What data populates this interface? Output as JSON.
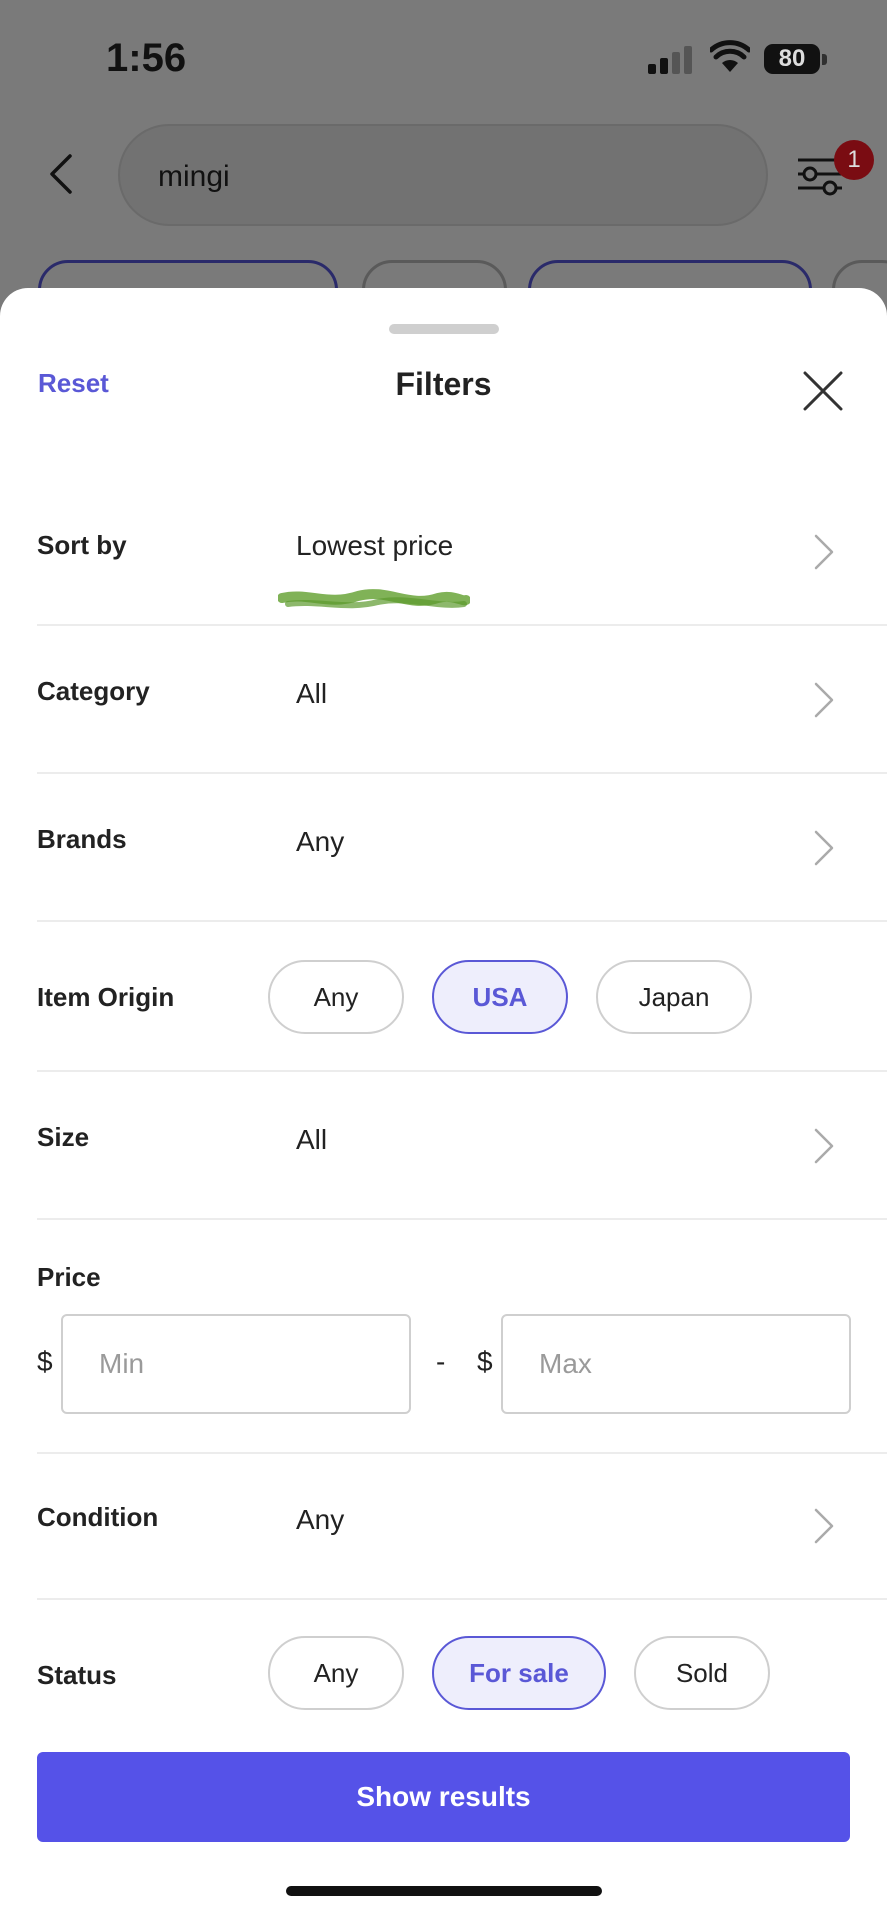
{
  "status_bar": {
    "time": "1:56",
    "battery": "80"
  },
  "search": {
    "query": "mingi",
    "filter_count": "1"
  },
  "sheet": {
    "title": "Filters",
    "reset_label": "Reset"
  },
  "filters": {
    "sort_by": {
      "label": "Sort by",
      "value": "Lowest price"
    },
    "category": {
      "label": "Category",
      "value": "All"
    },
    "brands": {
      "label": "Brands",
      "value": "Any"
    },
    "item_origin": {
      "label": "Item Origin",
      "options": [
        "Any",
        "USA",
        "Japan"
      ],
      "selected": "USA"
    },
    "size": {
      "label": "Size",
      "value": "All"
    },
    "price": {
      "label": "Price",
      "currency": "$",
      "min_placeholder": "Min",
      "max_placeholder": "Max",
      "separator": "-"
    },
    "condition": {
      "label": "Condition",
      "value": "Any"
    },
    "status": {
      "label": "Status",
      "options": [
        "Any",
        "For sale",
        "Sold"
      ],
      "selected": "For sale"
    }
  },
  "actions": {
    "show_results": "Show results"
  },
  "colors": {
    "accent": "#5552e8",
    "accent_text": "#5a58d6",
    "badge": "#b0101a"
  }
}
